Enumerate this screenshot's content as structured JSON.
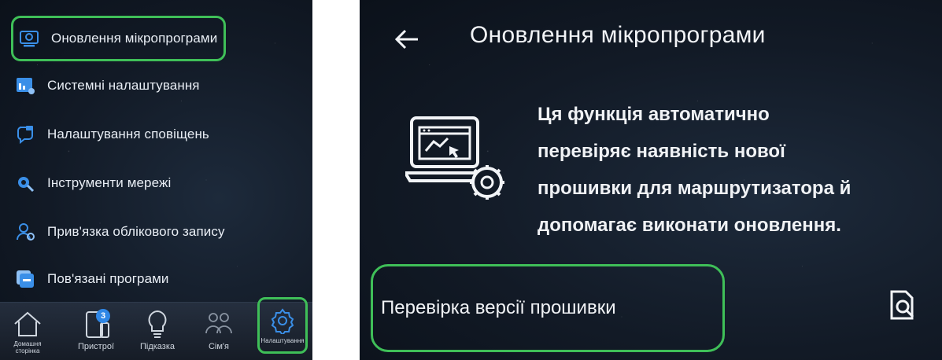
{
  "left_panel": {
    "menu": [
      {
        "label": "Оновлення мікропрограми",
        "icon": "firmware-update-icon"
      },
      {
        "label": "Системні налаштування",
        "icon": "system-settings-icon"
      },
      {
        "label": "Налаштування сповіщень",
        "icon": "notification-settings-icon"
      },
      {
        "label": "Інструменти мережі",
        "icon": "network-tools-icon"
      },
      {
        "label": "Прив'язка облікового запису",
        "icon": "account-binding-icon"
      },
      {
        "label": "Пов'язані програми",
        "icon": "related-apps-icon"
      }
    ],
    "bottom_nav": [
      {
        "label": "Домашня сторінка",
        "icon": "home-icon"
      },
      {
        "label": "Пристрої",
        "icon": "devices-icon",
        "badge": "3"
      },
      {
        "label": "Підказка",
        "icon": "lightbulb-icon"
      },
      {
        "label": "Сім'я",
        "icon": "family-icon"
      },
      {
        "label": "Налаштування",
        "icon": "gear-icon"
      }
    ]
  },
  "right_panel": {
    "title": "Оновлення мікропрограми",
    "description_lines": [
      "Ця функція автоматично",
      "перевіряє наявність нової",
      "прошивки для маршрутизатора й",
      "допомагає виконати оновлення."
    ],
    "check_version_label": "Перевірка версії прошивки"
  },
  "colors": {
    "highlight": "#3fbf58",
    "badge": "#2f87e6",
    "background": "#121a26"
  }
}
